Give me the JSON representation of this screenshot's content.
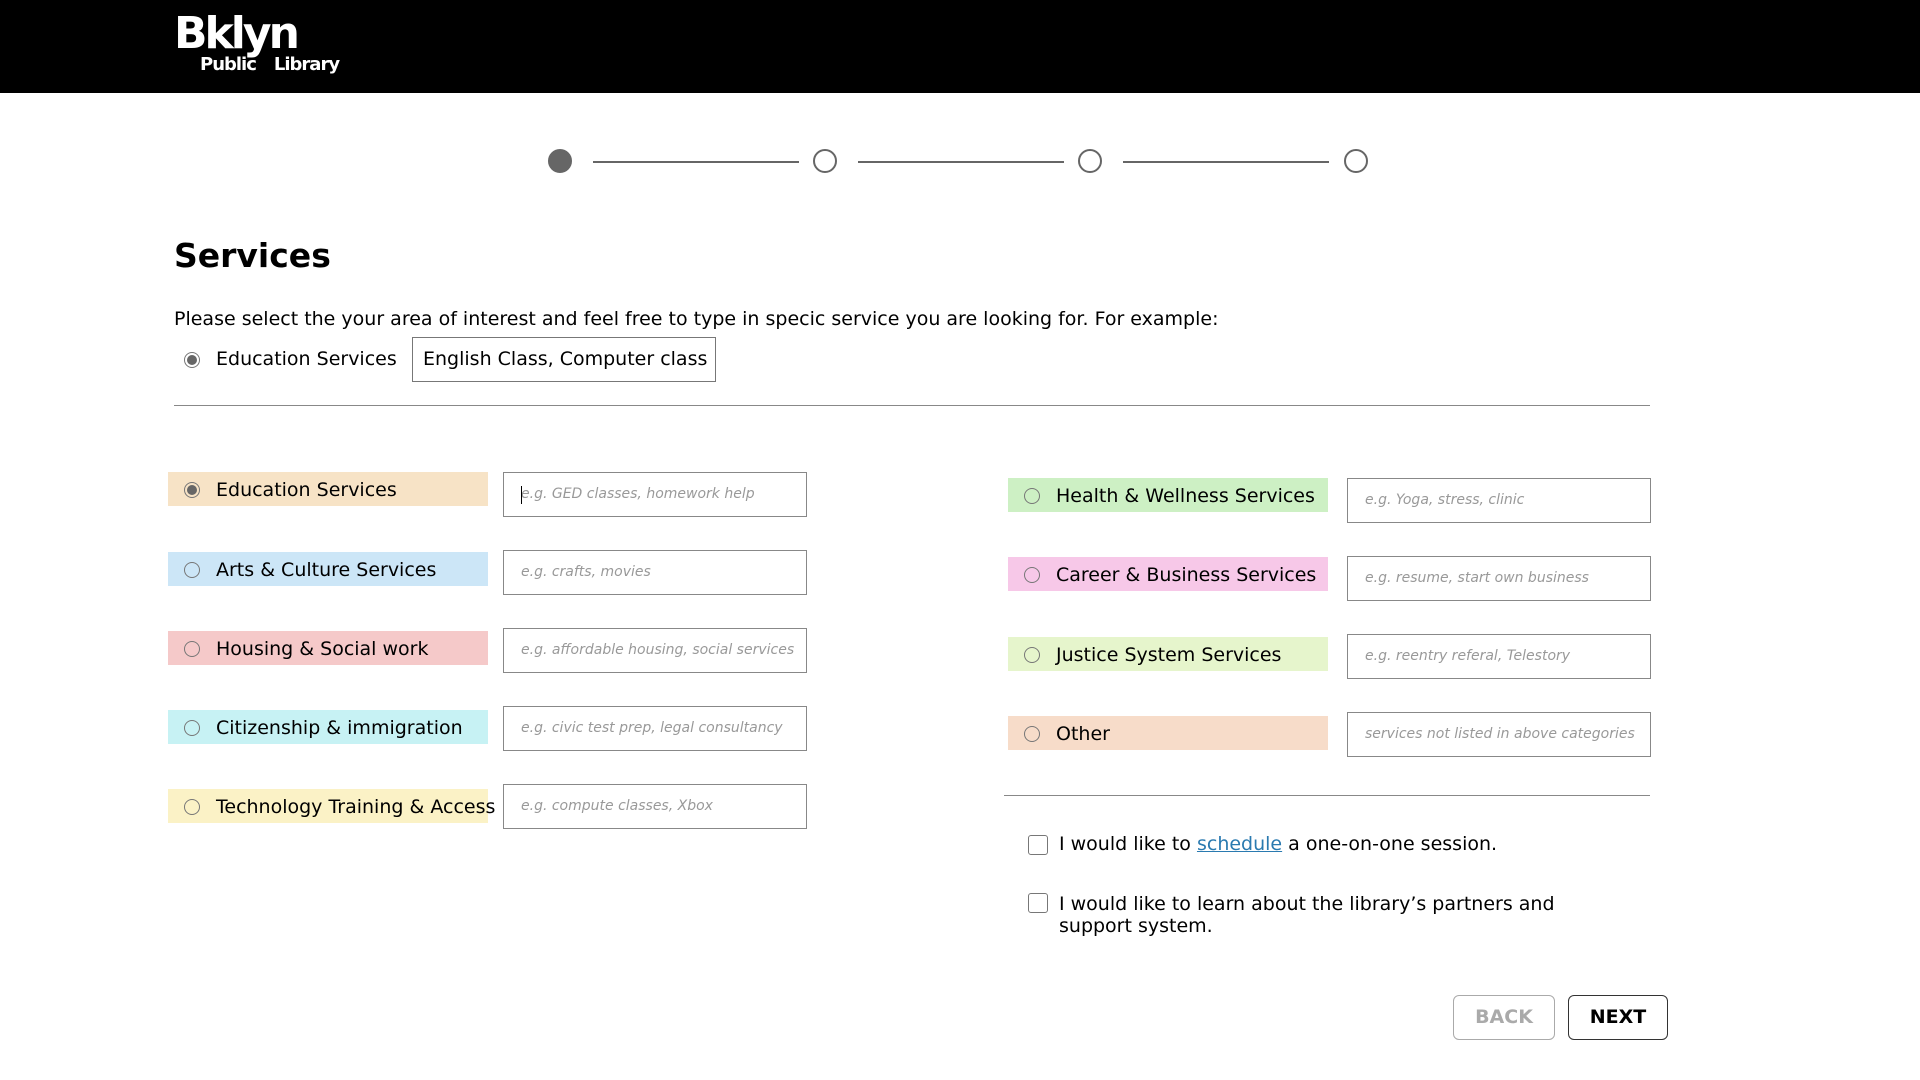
{
  "header": {
    "logo_top": "Bklyn",
    "logo_bottom_left": "Public",
    "logo_bottom_right": "Library"
  },
  "stepper": {
    "current_step": 1,
    "total_steps": 4
  },
  "page": {
    "title": "Services",
    "intro": "Please select the your area of interest and feel free to type in specic service you are looking for. For example:"
  },
  "example": {
    "label": "Education Services",
    "value": "English Class, Computer class"
  },
  "services_left": [
    {
      "label": "Education Services",
      "placeholder": "e.g. GED classes, homework help",
      "color": "#f7e3c6",
      "selected": true
    },
    {
      "label": "Arts & Culture Services",
      "placeholder": "e.g. crafts, movies",
      "color": "#cce6f7",
      "selected": false
    },
    {
      "label": "Housing & Social work",
      "placeholder": "e.g. affordable housing, social services",
      "color": "#f5c9c9",
      "selected": false
    },
    {
      "label": "Citizenship & immigration",
      "placeholder": "e.g. civic test prep, legal consultancy",
      "color": "#c7f2f4",
      "selected": false
    },
    {
      "label": "Technology Training & Access",
      "placeholder": "e.g. compute classes, Xbox",
      "color": "#fbf2c6",
      "selected": false
    }
  ],
  "services_right": [
    {
      "label": "Health & Wellness Services",
      "placeholder": "e.g. Yoga, stress, clinic",
      "color": "#cdf0c4",
      "selected": false
    },
    {
      "label": "Career & Business Services",
      "placeholder": "e.g. resume, start own business",
      "color": "#f7c8e8",
      "selected": false
    },
    {
      "label": "Justice System Services",
      "placeholder": "e.g. reentry referal, Telestory",
      "color": "#e6f5cc",
      "selected": false
    },
    {
      "label": "Other",
      "placeholder": "services not listed in above categories",
      "color": "#f7dcc9",
      "selected": false
    }
  ],
  "checkboxes": {
    "schedule_before": "I would like to ",
    "schedule_link": "schedule",
    "schedule_after": " a one-on-one session.",
    "partners_line1": "I would like to learn about the library’s partners and",
    "partners_line2": "support system."
  },
  "buttons": {
    "back": "BACK",
    "next": "NEXT"
  }
}
